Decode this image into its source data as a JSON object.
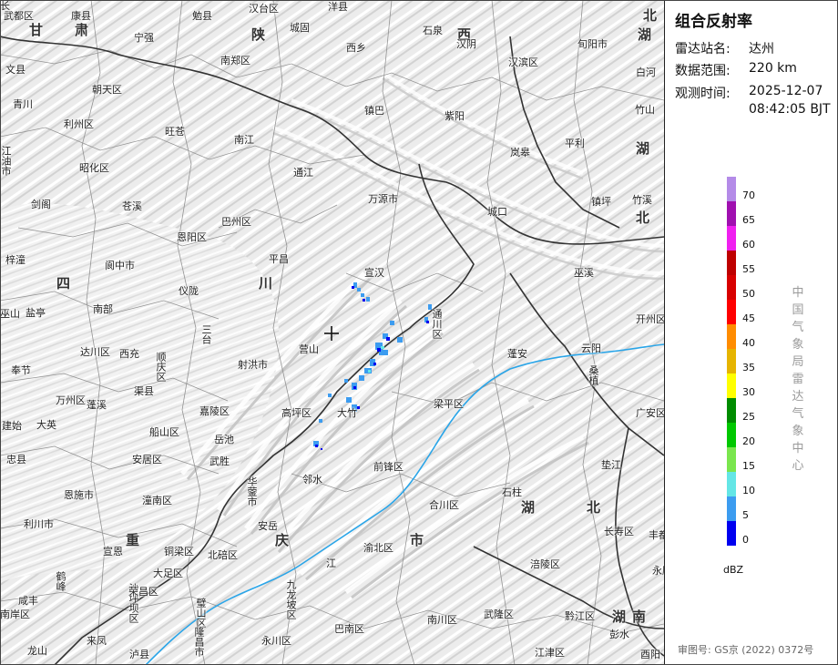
{
  "panel": {
    "title": "组合反射率",
    "station_label": "雷达站名:",
    "station_value": "达州",
    "range_label": "数据范围:",
    "range_value": "220 km",
    "time_label": "观测时间:",
    "time_date": "2025-12-07",
    "time_clock": "08:42:05 BJT",
    "center_name": "中国气象局雷达气象中心",
    "review_number": "审图号: GS京 (2022) 0372号"
  },
  "legend": {
    "unit": "dBZ",
    "ticks": [
      "70",
      "65",
      "60",
      "55",
      "50",
      "45",
      "40",
      "35",
      "30",
      "25",
      "20",
      "15",
      "10",
      "5",
      "0"
    ],
    "colors": [
      "#b48be8",
      "#a010b0",
      "#f020f0",
      "#be0000",
      "#d80000",
      "#ff0000",
      "#ff8c00",
      "#e6b400",
      "#ffff00",
      "#008c00",
      "#00c800",
      "#7ae64e",
      "#64e6e6",
      "#3c9cf0",
      "#0000f0"
    ]
  },
  "map": {
    "provinces": [
      {
        "id": "gansu-1",
        "text": "甘"
      },
      {
        "id": "gansu-2",
        "text": "肃"
      },
      {
        "id": "shaanxi-1",
        "text": "陕"
      },
      {
        "id": "shaanxi-2",
        "text": "西"
      },
      {
        "id": "sichuan-1",
        "text": "四"
      },
      {
        "id": "sichuan-2",
        "text": "川"
      },
      {
        "id": "chongqing-1",
        "text": "重"
      },
      {
        "id": "chongqing-2",
        "text": "庆"
      },
      {
        "id": "chongqing-3",
        "text": "市"
      },
      {
        "id": "hubei-1",
        "text": "湖"
      },
      {
        "id": "hubei-2",
        "text": "北"
      },
      {
        "id": "hubei-3",
        "text": "湖"
      },
      {
        "id": "hubei-4",
        "text": "北"
      },
      {
        "id": "hubei-5",
        "text": "湖"
      },
      {
        "id": "hubei-6",
        "text": "北"
      },
      {
        "id": "hubei-7",
        "text": "湖"
      },
      {
        "id": "hunan-1",
        "text": "南"
      }
    ],
    "places": [
      "武都区",
      "康县",
      "勉县",
      "汉台区",
      "洋县",
      "宁强",
      "城固",
      "石泉",
      "汉阴",
      "西乡",
      "旬阳市",
      "文县",
      "南郑区",
      "汉滨区",
      "白河",
      "青川",
      "朝天区",
      "镇巴",
      "紫阳",
      "竹山",
      "利州区",
      "旺苍",
      "南江",
      "平利",
      "岚皋",
      "江油市",
      "昭化区",
      "通江",
      "镇坪",
      "竹溪",
      "剑阁",
      "苍溪",
      "万源市",
      "巴州区",
      "城口",
      "梓潼",
      "恩阳区",
      "阆中市",
      "平昌",
      "宣汉",
      "巫溪",
      "盐亭",
      "南部",
      "仪陇",
      "通川区",
      "开州区",
      "巫山",
      "三台",
      "营山",
      "达川区",
      "西充",
      "顺庆区",
      "蓬安",
      "云阳",
      "奉节",
      "射洪市",
      "渠县",
      "高坪区",
      "大竹",
      "梁平区",
      "万州区",
      "蓬溪",
      "嘉陵区",
      "广安区",
      "建始",
      "大英",
      "船山区",
      "岳池",
      "前锋区",
      "忠县",
      "安居区",
      "武胜",
      "华蓥市",
      "邻水",
      "垫江",
      "恩施市",
      "潼南区",
      "合川区",
      "石柱",
      "利川市",
      "安岳",
      "长寿区",
      "宣恩",
      "铜梁区",
      "北碚区",
      "渝北区",
      "丰都",
      "鹤峰",
      "大足区",
      "沙坪坝区",
      "九龙坡区",
      "涪陵区",
      "咸丰",
      "荣昌区",
      "璧山区",
      "南岸区",
      "隆昌市",
      "巴南区",
      "武隆区",
      "黔江区",
      "来凤",
      "永川区",
      "南川区",
      "彭水",
      "龙山",
      "泸县",
      "江津区",
      "酉阳",
      "永顺",
      "桑植",
      "江",
      "长"
    ]
  }
}
